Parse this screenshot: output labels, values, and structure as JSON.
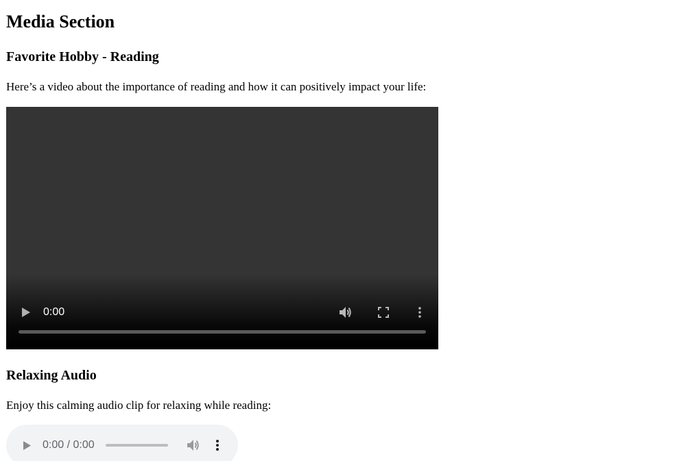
{
  "section": {
    "title": "Media Section"
  },
  "hobby": {
    "heading": "Favorite Hobby - Reading",
    "description": "Here’s a video about the importance of reading and how it can positively impact your life:"
  },
  "video_player": {
    "time": "0:00",
    "progress": 0,
    "icons": {
      "play": "play-icon",
      "volume": "volume-icon",
      "fullscreen": "fullscreen-icon",
      "more": "more-options-icon"
    },
    "colors": {
      "background": "#343434",
      "controls": "#ffffff"
    }
  },
  "audio": {
    "heading": "Relaxing Audio",
    "description": "Enjoy this calming audio clip for relaxing while reading:"
  },
  "audio_player": {
    "time": "0:00 / 0:00",
    "progress": 0,
    "icons": {
      "play": "play-icon",
      "volume": "volume-icon",
      "more": "more-options-icon"
    },
    "colors": {
      "background": "#f1f3f4",
      "controls": "#5f6368"
    }
  }
}
